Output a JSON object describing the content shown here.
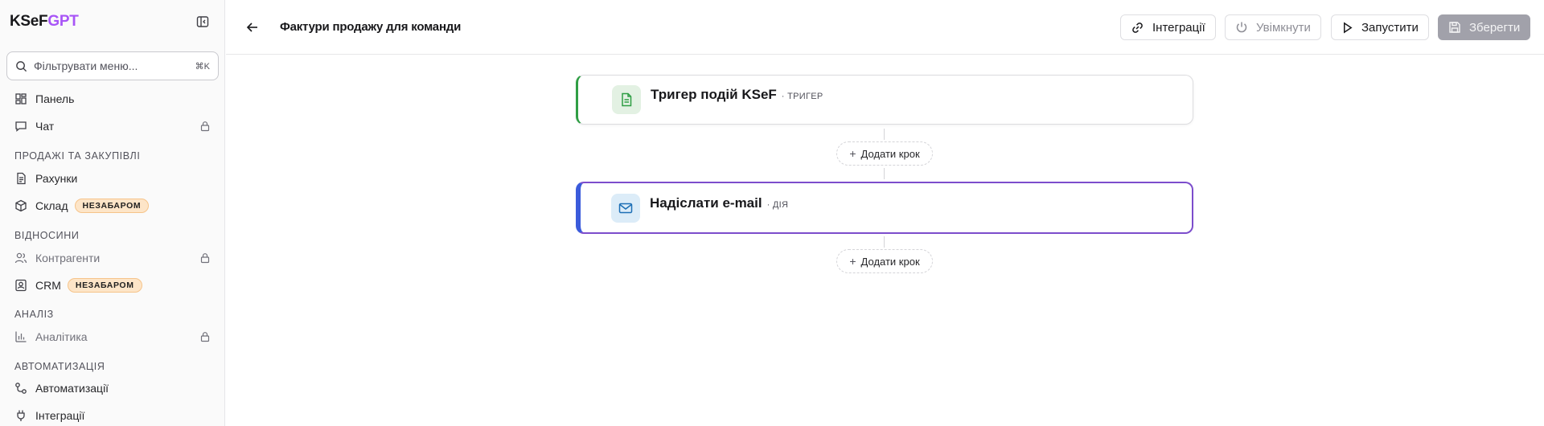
{
  "brand": {
    "ksef": "KSeF",
    "gpt": "GPT"
  },
  "search": {
    "placeholder": "Фільтрувати меню...",
    "shortcut": "⌘K"
  },
  "sidebar": {
    "items": [
      {
        "label": "Панель",
        "icon": "dashboard-icon"
      },
      {
        "label": "Чат",
        "icon": "chat-icon",
        "locked": true
      },
      {
        "label": "Рахунки",
        "icon": "invoice-icon"
      },
      {
        "label": "Склад",
        "icon": "box-icon",
        "badge": "НЕЗАБАРОМ"
      },
      {
        "label": "Контрагенти",
        "icon": "users-icon",
        "locked": true
      },
      {
        "label": "CRM",
        "icon": "contact-icon",
        "badge": "НЕЗАБАРОМ"
      },
      {
        "label": "Аналітика",
        "icon": "chart-icon",
        "locked": true
      },
      {
        "label": "Автоматизації",
        "icon": "workflow-icon"
      },
      {
        "label": "Інтеграції",
        "icon": "plug-icon"
      }
    ],
    "sections": [
      "ПРОДАЖІ ТА ЗАКУПІВЛІ",
      "ВІДНОСИНИ",
      "АНАЛІЗ",
      "АВТОМАТИЗАЦІЯ"
    ]
  },
  "header": {
    "title": "Фактури продажу для команди",
    "integrations": "Інтеграції",
    "enable": "Увімкнути",
    "run": "Запустити",
    "save": "Зберегти"
  },
  "nodes": [
    {
      "title": "Тригер подій KSeF",
      "type": "· ТРИГЕР",
      "icon": "document-icon"
    },
    {
      "title": "Надіслати e-mail",
      "type": "· ДІЯ",
      "icon": "mail-icon"
    }
  ],
  "add_step": "Додати крок",
  "colors": {
    "accent": "#a855f7",
    "trigger": "#2f9e44",
    "action_border": "#7c4dcc",
    "action_left": "#3b5bdb",
    "badge_bg": "#fde5c8"
  }
}
